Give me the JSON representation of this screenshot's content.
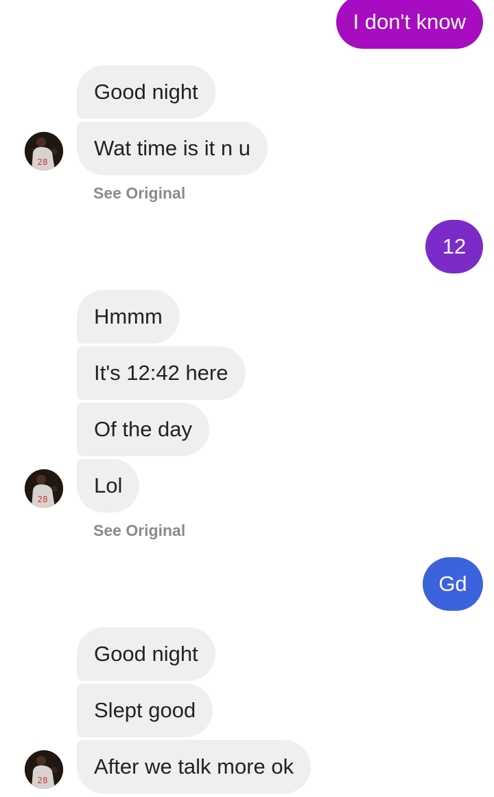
{
  "conversation": {
    "sent_1": {
      "text": "I don't know",
      "color": "#a70cc0"
    },
    "group_1": [
      {
        "text": "Good night"
      },
      {
        "text": "Wat time is it n u"
      }
    ],
    "see_original_1": "See Original",
    "sent_2": {
      "text": "12",
      "color": "#7a2bc8"
    },
    "group_2": [
      {
        "text": "Hmmm"
      },
      {
        "text": "It's 12:42 here"
      },
      {
        "text": "Of the day"
      },
      {
        "text": "Lol"
      }
    ],
    "see_original_2": "See Original",
    "sent_3": {
      "text": "Gd",
      "color": "#3c63dd"
    },
    "group_3": [
      {
        "text": "Good night"
      },
      {
        "text": "Slept good"
      },
      {
        "text": "After we talk more ok"
      }
    ]
  },
  "contact": {
    "avatar_icon": "contact-avatar-jersey-28"
  }
}
